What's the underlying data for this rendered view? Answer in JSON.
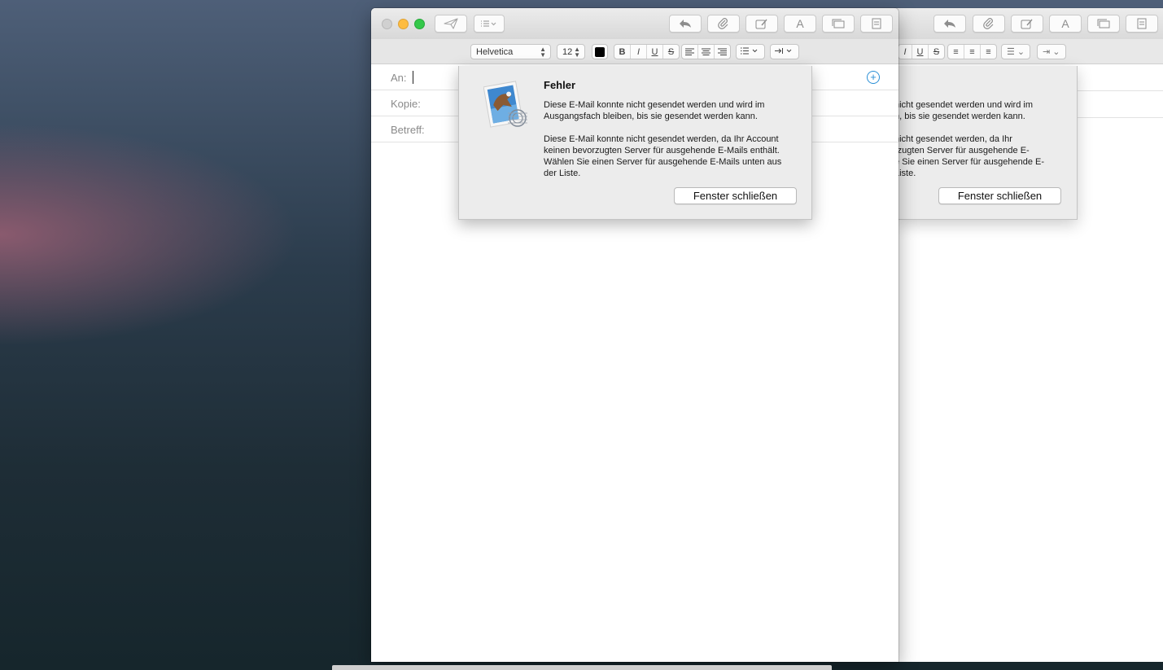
{
  "compose": {
    "fields": {
      "to_label": "An:",
      "cc_label": "Kopie:",
      "subject_label": "Betreff:"
    }
  },
  "format_bar": {
    "font": "Helvetica",
    "size": "12",
    "text_color": "#000000",
    "bold": "B",
    "italic": "I",
    "underline": "U",
    "strike": "S"
  },
  "toolbar": {
    "send_icon": "paper-plane-icon",
    "header_fields_icon": "list-dropdown-icon",
    "reply_icon": "reply-icon",
    "attach_icon": "paperclip-icon",
    "markup_icon": "annotate-icon",
    "fonts_label": "A",
    "photo_browser_icon": "photo-browser-icon",
    "stationery_icon": "stationery-icon"
  },
  "error_sheet": {
    "title": "Fehler",
    "message1": "Diese E-Mail konnte nicht gesendet werden und wird im Ausgangsfach bleiben, bis sie gesendet werden kann.",
    "message2": "Diese E-Mail konnte nicht gesendet werden, da Ihr Account keinen bevorzugten Server für ausgehende E-Mails enthält. Wählen Sie einen Server für ausgehende E-Mails unten aus der Liste.",
    "close_button": "Fenster schließen",
    "icon": "mail-stamp-icon"
  },
  "right_clone": {
    "line1": "nicht gesendet werden und wird im",
    "line2": "n, bis sie gesendet werden kann.",
    "line3": "nicht gesendet werden, da Ihr",
    "line4": "rzugten Server für ausgehende E-",
    "line5": "e Sie einen Server für ausgehende E-",
    "line6": "Liste.",
    "close_button": "Fenster schließen"
  }
}
